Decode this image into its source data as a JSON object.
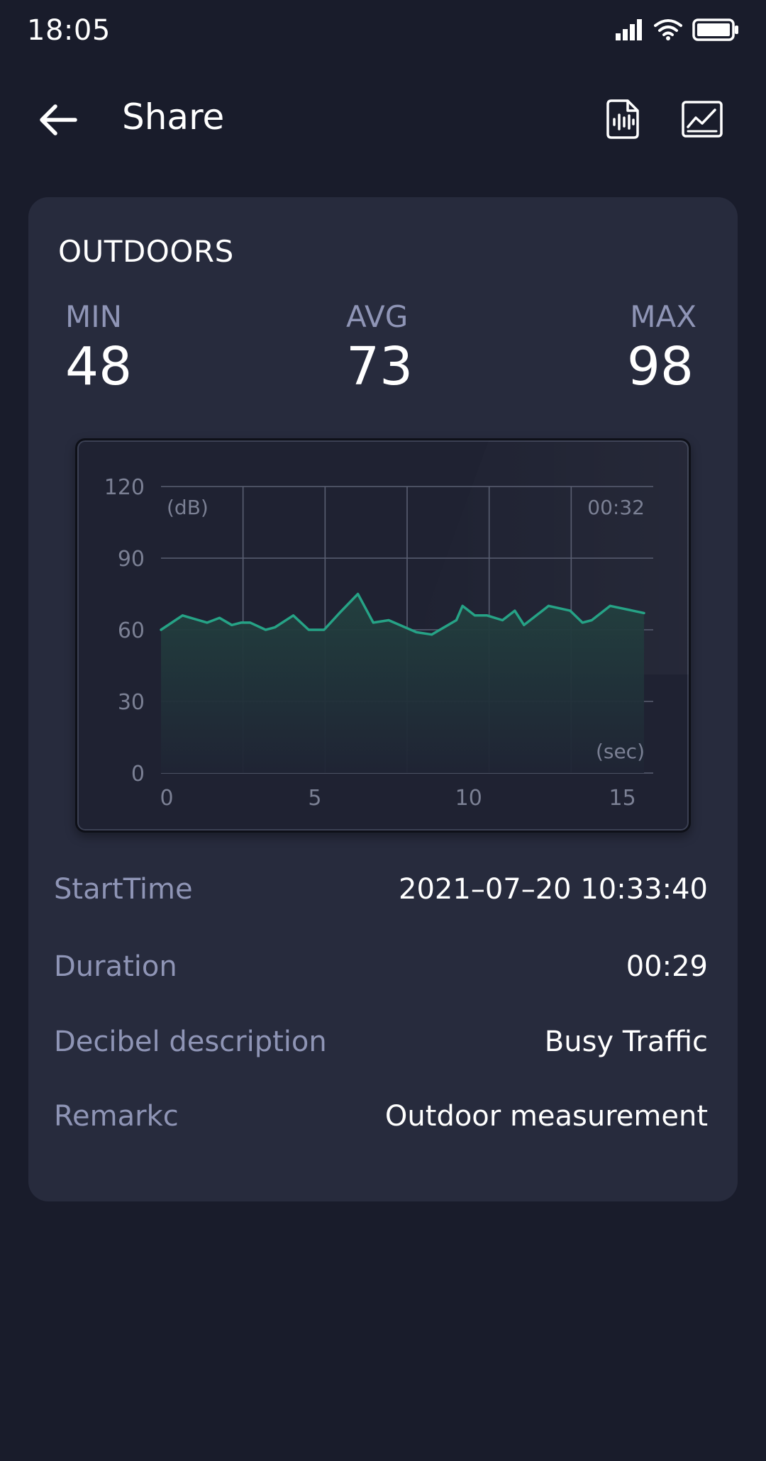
{
  "status_bar": {
    "time": "18:05"
  },
  "app_bar": {
    "title": "Share",
    "back_icon": "arrow-left-icon",
    "actions": [
      "audio-file-icon",
      "chart-image-icon"
    ]
  },
  "card": {
    "title": "OUTDOORS",
    "stats": {
      "min_label": "MIN",
      "min_value": "48",
      "avg_label": "AVG",
      "avg_value": "73",
      "max_label": "MAX",
      "max_value": "98"
    },
    "details": {
      "start_time_label": "StartTime",
      "start_time_value": "2021–07–20 10:33:40",
      "duration_label": "Duration",
      "duration_value": "00:29",
      "description_label": "Decibel description",
      "description_value": "Busy Traffic",
      "remark_label": "Remarkc",
      "remark_value": "Outdoor measurement"
    }
  },
  "chart_data": {
    "type": "area",
    "y_unit_label": "(dB)",
    "x_unit_label": "(sec)",
    "time_readout": "00:32",
    "ylim": [
      0,
      120
    ],
    "xlim": [
      0,
      16
    ],
    "y_ticks": [
      "0",
      "30",
      "60",
      "90",
      "120"
    ],
    "x_ticks": [
      "0",
      "5",
      "10",
      "15"
    ],
    "x_tick_values": [
      0,
      5,
      10,
      15
    ],
    "grid": true,
    "line_color": "#26a386",
    "x": [
      0,
      0.7,
      1.5,
      1.9,
      2.3,
      2.6,
      2.9,
      3.4,
      3.7,
      4.3,
      4.8,
      5.3,
      5.8,
      6.4,
      6.9,
      7.4,
      8.3,
      8.8,
      9.6,
      9.8,
      10.2,
      10.6,
      11.1,
      11.5,
      11.8,
      12.6,
      13.3,
      13.7,
      14.0,
      14.6,
      15.7
    ],
    "y": [
      60,
      66,
      63,
      65,
      62,
      63,
      63,
      60,
      61,
      66,
      60,
      60,
      67,
      75,
      63,
      64,
      59,
      58,
      64,
      70,
      66,
      66,
      64,
      68,
      62,
      70,
      68,
      63,
      64,
      70,
      67
    ]
  },
  "colors": {
    "background": "#191c2b",
    "card": "#272b3d",
    "label": "#8f95b6",
    "accent": "#26a386"
  }
}
